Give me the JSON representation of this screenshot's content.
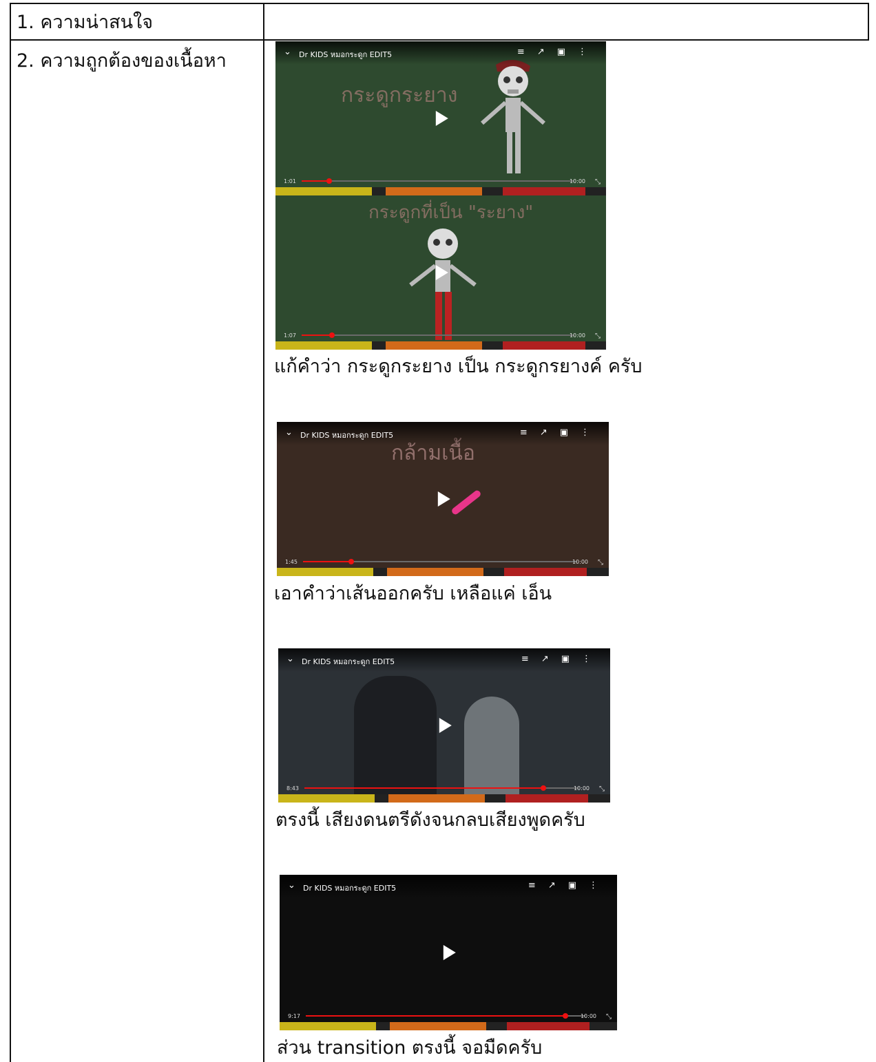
{
  "table": {
    "rows": [
      {
        "label": "1. ความน่าสนใจ"
      },
      {
        "label": "2. ความถูกต้องของเนื้อหา"
      }
    ]
  },
  "videos": [
    {
      "title": "Dr KIDS หมอกระดูก EDIT5",
      "frames": [
        {
          "time": "1:01",
          "duration": "10:00",
          "progress": 0.1,
          "overlay": "กระดูกระยาง"
        },
        {
          "time": "1:07",
          "duration": "10:00",
          "progress": 0.11,
          "overlay": "กระดูกที่เป็น \"ระยาง\""
        }
      ],
      "caption": "แก้คำว่า กระดูกระยาง เป็น กระดูกรยางค์ ครับ"
    },
    {
      "title": "Dr KIDS หมอกระดูก EDIT5",
      "frames": [
        {
          "time": "1:45",
          "duration": "10:00",
          "progress": 0.175,
          "overlay": "กล้ามเนื้อ"
        }
      ],
      "caption": "เอาคำว่าเส้นออกครับ เหลือแค่ เอ็น"
    },
    {
      "title": "Dr KIDS หมอกระดูก EDIT5",
      "frames": [
        {
          "time": "8:43",
          "duration": "10:00",
          "progress": 0.872,
          "overlay": ""
        }
      ],
      "caption": "ตรงนี้ เสียงดนตรีดังจนกลบเสียงพูดครับ"
    },
    {
      "title": "Dr KIDS หมอกระดูก EDIT5",
      "frames": [
        {
          "time": "9:17",
          "duration": "10:00",
          "progress": 0.928,
          "overlay": ""
        }
      ],
      "caption": "ส่วน transition ตรงนี้ จอมืดครับ"
    }
  ],
  "colors": {
    "board_green": "#2f4f2f",
    "progress_red": "#e11111"
  }
}
